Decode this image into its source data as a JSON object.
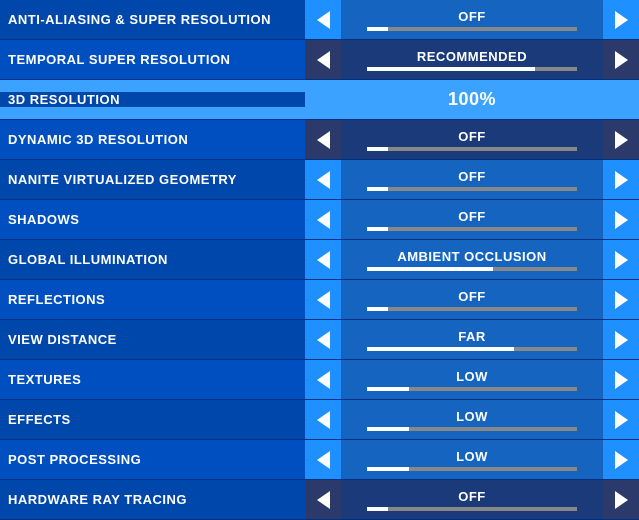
{
  "settings": [
    {
      "id": "anti-aliasing",
      "label": "ANTI-ALIASING & SUPER RESOLUTION",
      "value": "OFF",
      "arrowStyle": "blue",
      "barFill": 10,
      "hasBar": true,
      "rowClass": "row-aa"
    },
    {
      "id": "temporal-super-resolution",
      "label": "TEMPORAL SUPER RESOLUTION",
      "value": "RECOMMENDED",
      "arrowStyle": "dark",
      "barFill": 80,
      "hasBar": true,
      "rowClass": "row-temporal"
    },
    {
      "id": "3d-resolution",
      "label": "3D RESOLUTION",
      "value": "100%",
      "arrowStyle": "none",
      "barFill": 0,
      "hasBar": false,
      "rowClass": "row-3d"
    },
    {
      "id": "dynamic-3d-resolution",
      "label": "DYNAMIC 3D RESOLUTION",
      "value": "OFF",
      "arrowStyle": "dark",
      "barFill": 10,
      "hasBar": true,
      "rowClass": "row-dynamic"
    },
    {
      "id": "nanite",
      "label": "NANITE VIRTUALIZED GEOMETRY",
      "value": "OFF",
      "arrowStyle": "blue",
      "barFill": 10,
      "hasBar": true,
      "rowClass": "row-nanite"
    },
    {
      "id": "shadows",
      "label": "SHADOWS",
      "value": "OFF",
      "arrowStyle": "blue",
      "barFill": 10,
      "hasBar": true,
      "rowClass": "row-shadows"
    },
    {
      "id": "global-illumination",
      "label": "GLOBAL ILLUMINATION",
      "value": "AMBIENT OCCLUSION",
      "arrowStyle": "blue",
      "barFill": 60,
      "hasBar": true,
      "rowClass": "row-gi"
    },
    {
      "id": "reflections",
      "label": "REFLECTIONS",
      "value": "OFF",
      "arrowStyle": "blue",
      "barFill": 10,
      "hasBar": true,
      "rowClass": "row-reflections"
    },
    {
      "id": "view-distance",
      "label": "VIEW DISTANCE",
      "value": "FAR",
      "arrowStyle": "blue",
      "barFill": 70,
      "hasBar": true,
      "rowClass": "row-view-distance"
    },
    {
      "id": "textures",
      "label": "TEXTURES",
      "value": "LOW",
      "arrowStyle": "blue",
      "barFill": 20,
      "hasBar": true,
      "rowClass": "row-textures"
    },
    {
      "id": "effects",
      "label": "EFFECTS",
      "value": "LOW",
      "arrowStyle": "blue",
      "barFill": 20,
      "hasBar": true,
      "rowClass": "row-effects"
    },
    {
      "id": "post-processing",
      "label": "POST PROCESSING",
      "value": "LOW",
      "arrowStyle": "blue",
      "barFill": 20,
      "hasBar": true,
      "rowClass": "row-post-processing"
    },
    {
      "id": "hardware-ray-tracing",
      "label": "HARDWARE RAY TRACING",
      "value": "OFF",
      "arrowStyle": "dark",
      "barFill": 10,
      "hasBar": true,
      "rowClass": "row-hardware"
    }
  ]
}
